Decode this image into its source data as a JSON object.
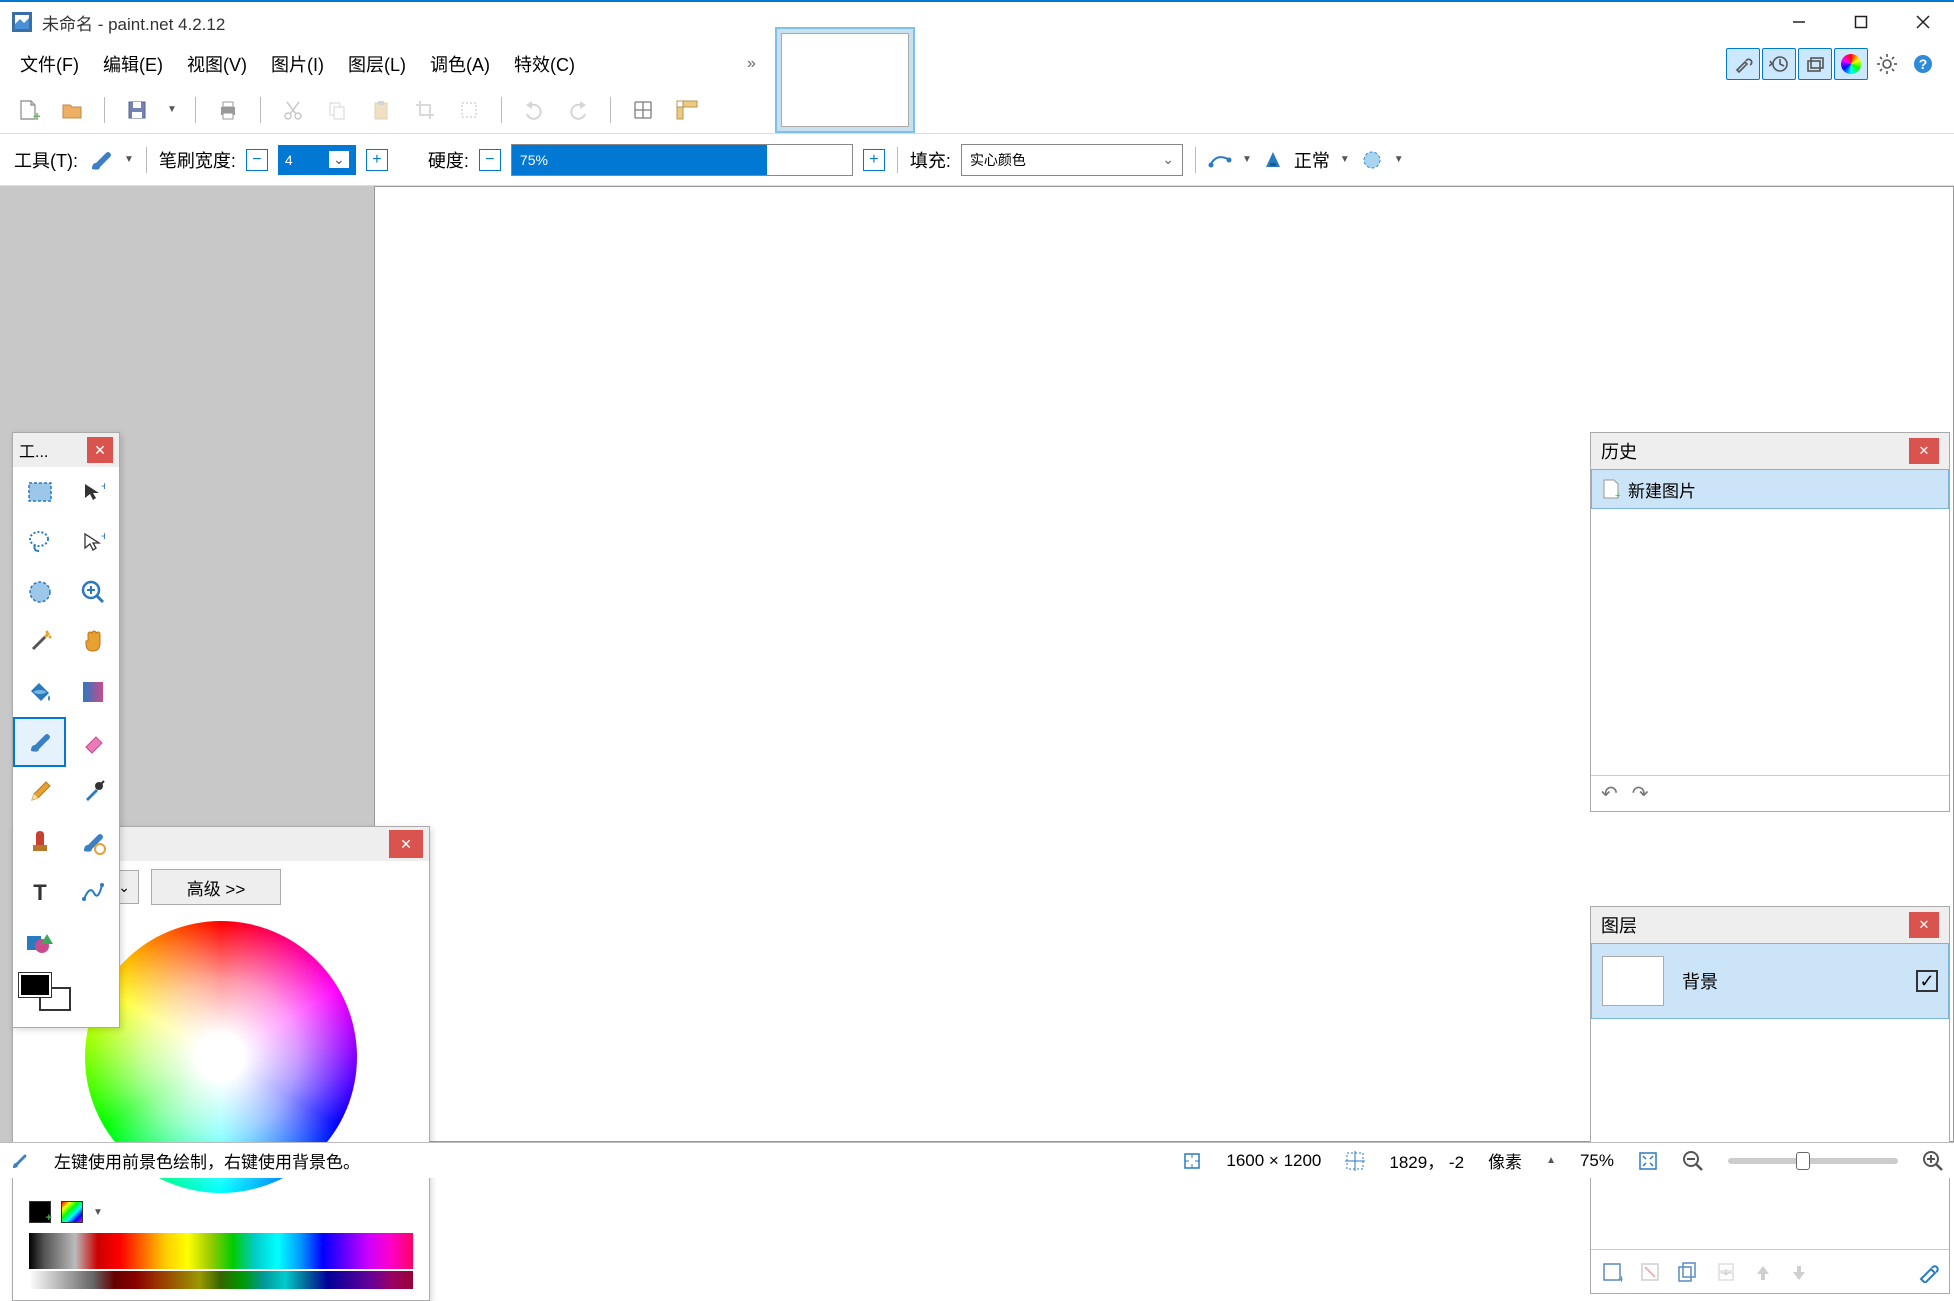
{
  "title": "未命名 - paint.net 4.2.12",
  "menu": {
    "file": "文件(F)",
    "edit": "编辑(E)",
    "view": "视图(V)",
    "image": "图片(I)",
    "layers": "图层(L)",
    "adjust": "调色(A)",
    "effects": "特效(C)"
  },
  "toolbar2": {
    "tools_label": "工具(T):",
    "brush_label": "笔刷宽度:",
    "brush_width": "4",
    "hardness_label": "硬度:",
    "hardness": "75%",
    "hardness_pct": 75,
    "fill_label": "填充:",
    "fill_mode": "实心颜色",
    "blend_label": "正常"
  },
  "tools_win": {
    "title": "工..."
  },
  "colors_win": {
    "advanced": "高级 >>"
  },
  "history": {
    "title": "历史",
    "item": "新建图片"
  },
  "layers": {
    "title": "图层",
    "bg_name": "背景"
  },
  "status": {
    "hint": "左键使用前景色绘制，右键使用背景色。",
    "size": "1600 × 1200",
    "pos": "1829， -2",
    "unit": "像素",
    "zoom": "75%"
  }
}
